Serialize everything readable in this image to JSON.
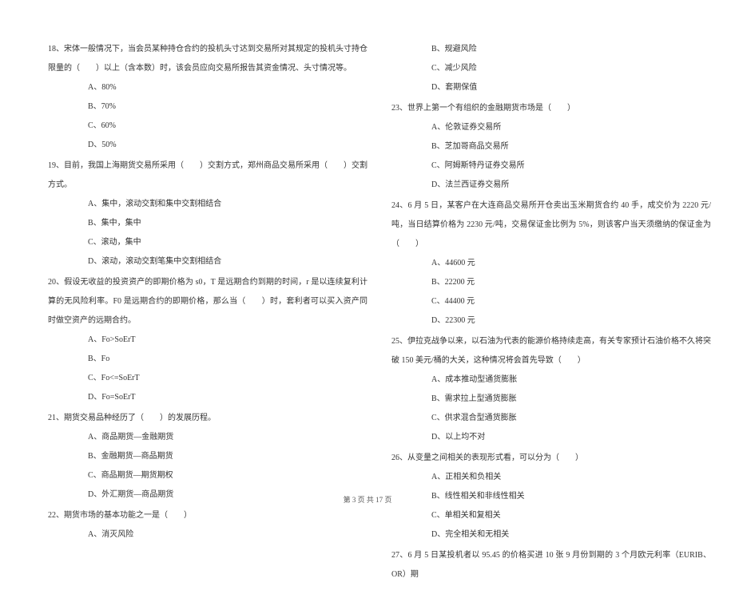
{
  "left": {
    "q18": {
      "text": "18、宋体一般情况下，当会员某种持仓合约的投机头寸达到交易所对其规定的投机头寸持仓限量的（　　）以上（含本数）时，该会员应向交易所报告其资金情况、头寸情况等。",
      "a": "A、80%",
      "b": "B、70%",
      "c": "C、60%",
      "d": "D、50%"
    },
    "q19": {
      "text": "19、目前，我国上海期货交易所采用（　　）交割方式，郑州商品交易所采用（　　）交割方式。",
      "a": "A、集中，滚动交割和集中交割相结合",
      "b": "B、集中，集中",
      "c": "C、滚动，集中",
      "d": "D、滚动，滚动交割笔集中交割相结合"
    },
    "q20": {
      "text": "20、假设无收益的投资资产的即期价格为 s0，T 是远期合约到期的时间，r 是以连续复利计算的无风险利率。F0 是远期合约的即期价格，那么当（　　）时，套利者可以买入资产同时做空资产的远期合约。",
      "a": "A、Fo>SoErT",
      "b": "B、Fo",
      "c": "C、Fo<=SoErT",
      "d": "D、Fo=SoErT"
    },
    "q21": {
      "text": "21、期货交易品种经历了（　　）的发展历程。",
      "a": "A、商品期货—金融期货",
      "b": "B、金融期货—商品期货",
      "c": "C、商品期货—期货期权",
      "d": "D、外汇期货—商品期货"
    },
    "q22": {
      "text": "22、期货市场的基本功能之一是（　　）",
      "a": "A、消灭风险"
    }
  },
  "right": {
    "q22cont": {
      "b": "B、规避风险",
      "c": "C、减少风险",
      "d": "D、套期保值"
    },
    "q23": {
      "text": "23、世界上第一个有组织的金融期货市场是（　　）",
      "a": "A、伦敦证券交易所",
      "b": "B、芝加哥商品交易所",
      "c": "C、阿姆斯特丹证券交易所",
      "d": "D、法兰西证券交易所"
    },
    "q24": {
      "text": "24、6 月 5 日，某客户在大连商品交易所开仓卖出玉米期货合约 40 手，成交价为 2220 元/吨，当日结算价格为 2230 元/吨，交易保证金比例为 5%，则该客户当天须缴纳的保证金为（　　）",
      "a": "A、44600 元",
      "b": "B、22200 元",
      "c": "C、44400 元",
      "d": "D、22300 元"
    },
    "q25": {
      "text": "25、伊拉克战争以来，以石油为代表的能源价格持续走高，有关专家预计石油价格不久将突破 150 美元/桶的大关，这种情况将会首先导致（　　）",
      "a": "A、成本推动型通货膨胀",
      "b": "B、需求拉上型通货膨胀",
      "c": "C、供求混合型通货膨胀",
      "d": "D、以上均不对"
    },
    "q26": {
      "text": "26、从变量之间相关的表现形式看，可以分为（　　）",
      "a": "A、正相关和负相关",
      "b": "B、线性相关和非线性相关",
      "c": "C、单相关和复相关",
      "d": "D、完全相关和无相关"
    },
    "q27": {
      "text": "27、6 月 5 日某投机者以 95.45 的价格买进 10 张 9 月份到期的 3 个月欧元利率（EURIB、OR）期"
    }
  },
  "footer": "第 3 页 共 17 页"
}
